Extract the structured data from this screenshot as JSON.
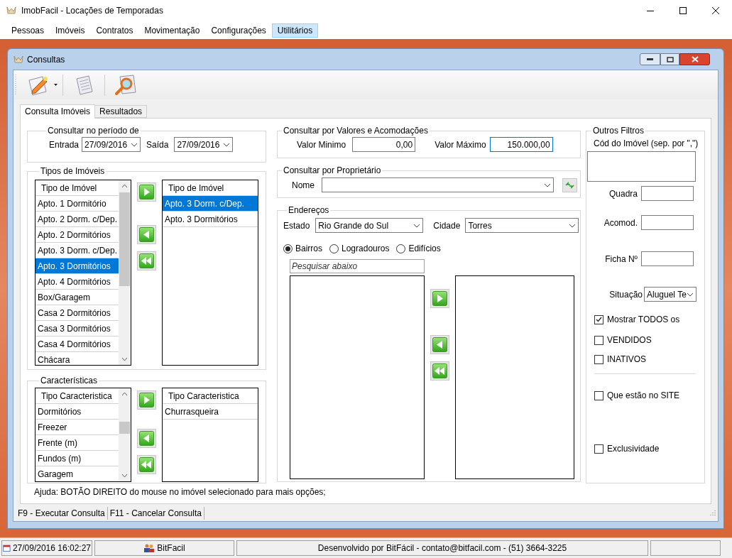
{
  "window": {
    "title": "ImobFacil - Locações de Temporadas"
  },
  "menu": [
    {
      "label": "Pessoas",
      "selected": false
    },
    {
      "label": "Imóveis",
      "selected": false
    },
    {
      "label": "Contratos",
      "selected": false
    },
    {
      "label": "Movimentação",
      "selected": false
    },
    {
      "label": "Configurações",
      "selected": false
    },
    {
      "label": "Utilitários",
      "selected": true
    }
  ],
  "child_window": {
    "title": "Consultas"
  },
  "tabs": [
    {
      "label": "Consulta Imóveis",
      "selected": true
    },
    {
      "label": "Resultados",
      "selected": false
    }
  ],
  "period": {
    "title": "Consultar no período de",
    "entrada_label": "Entrada",
    "entrada_value": "27/09/2016",
    "saida_label": "Saída",
    "saida_value": "27/09/2016"
  },
  "tipos": {
    "title": "Tipos de Imóveis",
    "available": {
      "header": "Tipo de Imóvel",
      "items": [
        {
          "label": "Apto. 1 Dormitório",
          "selected": false
        },
        {
          "label": "Apto. 2 Dorm. c/Dep.",
          "selected": false
        },
        {
          "label": "Apto. 2 Dormitórios",
          "selected": false
        },
        {
          "label": "Apto. 3 Dorm. c/Dep.",
          "selected": false
        },
        {
          "label": "Apto. 3 Dormitórios",
          "selected": true
        },
        {
          "label": "Apto. 4 Dormitórios",
          "selected": false
        },
        {
          "label": "Box/Garagem",
          "selected": false
        },
        {
          "label": "Casa 2 Dormitórios",
          "selected": false
        },
        {
          "label": "Casa 3 Dormitórios",
          "selected": false
        },
        {
          "label": "Casa 4 Dormitórios",
          "selected": false
        },
        {
          "label": "Chácara",
          "selected": false
        }
      ]
    },
    "chosen": {
      "header": "Tipo de Imóvel",
      "items": [
        {
          "label": "Apto. 3 Dorm. c/Dep.",
          "selected": true
        },
        {
          "label": "Apto. 3 Dormitórios",
          "selected": false
        }
      ]
    }
  },
  "caracteristicas": {
    "title": "Características",
    "available": {
      "header": "Tipo Caracteristica",
      "items": [
        {
          "label": "Dormitórios",
          "selected": false
        },
        {
          "label": "Freezer",
          "selected": false
        },
        {
          "label": "Frente (m)",
          "selected": false
        },
        {
          "label": "Fundos (m)",
          "selected": false
        },
        {
          "label": "Garagem",
          "selected": false
        }
      ]
    },
    "chosen": {
      "header": "Tipo Caracteristica",
      "items": [
        {
          "label": "Churrasqueira",
          "selected": false
        }
      ]
    }
  },
  "help": "Ajuda: BOTÃO DIREITO do mouse no imóvel selecionado para mais opções;",
  "valores": {
    "title": "Consultar por Valores e Acomodações",
    "min_label": "Valor Minimo",
    "min_value": "0,00",
    "min_focused": false,
    "max_label": "Valor Máximo",
    "max_value": "150.000,00",
    "max_focused": true
  },
  "proprietario": {
    "title": "Consultar por Proprietário",
    "name_label": "Nome"
  },
  "enderecos": {
    "title": "Endereços",
    "estado_label": "Estado",
    "estado_value": "Rio Grande do Sul",
    "cidade_label": "Cidade",
    "cidade_value": "Torres",
    "radios": [
      {
        "label": "Bairros",
        "selected": true
      },
      {
        "label": "Logradouros",
        "selected": false
      },
      {
        "label": "Edifícios",
        "selected": false
      }
    ],
    "search_placeholder": "Pesquisar abaixo"
  },
  "outros": {
    "title": "Outros Filtros",
    "cod_label": "Cód do Imóvel (sep. por \",\")",
    "quadra_label": "Quadra",
    "acomod_label": "Acomod.",
    "ficha_label": "Ficha Nº",
    "situacao_label": "Situação",
    "situacao_value": "Aluguel Te",
    "checks": [
      {
        "label": "Mostrar TODOS os",
        "checked": true
      },
      {
        "label": "VENDIDOS",
        "checked": false
      },
      {
        "label": "INATIVOS",
        "checked": false
      },
      {
        "label": "Que estão no SITE",
        "checked": false
      },
      {
        "label": "Exclusividade",
        "checked": false
      }
    ]
  },
  "shortcuts": [
    "F9 - Executar Consulta",
    "F11 - Cancelar Consulta"
  ],
  "status_bar": {
    "datetime": "27/09/2016 16:02:27",
    "user": "BitFacil",
    "info": "Desenvolvido por BitFácil - contato@bitfacil.com - (51) 3664-3225"
  }
}
